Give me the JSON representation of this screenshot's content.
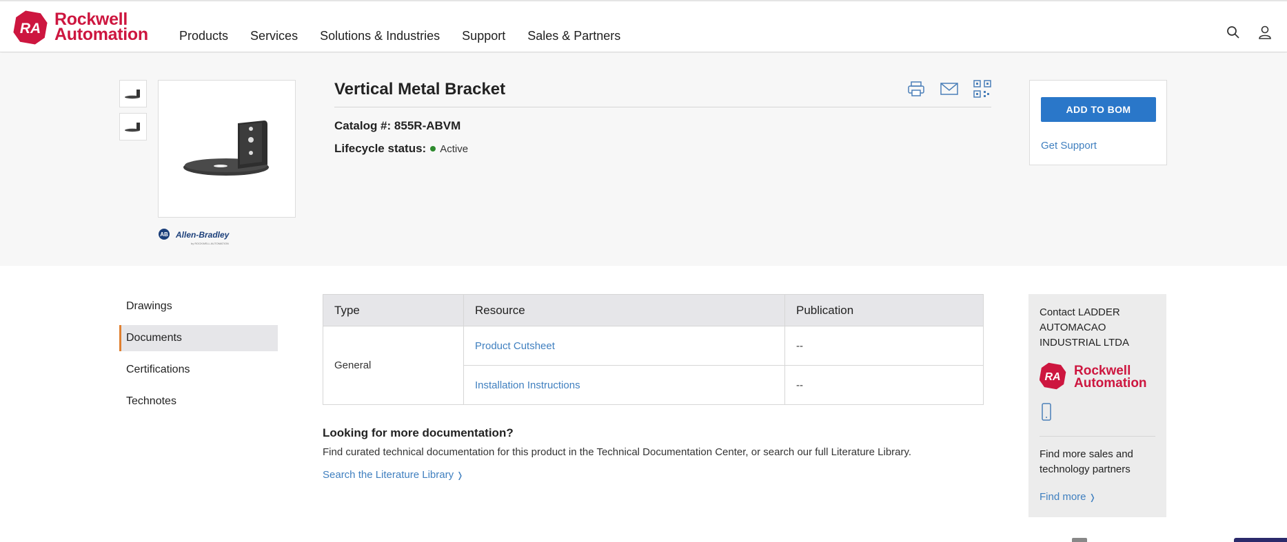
{
  "header": {
    "logo": {
      "mark": "RA",
      "line1": "Rockwell",
      "line2": "Automation"
    },
    "nav": [
      "Products",
      "Services",
      "Solutions & Industries",
      "Support",
      "Sales & Partners"
    ],
    "icons": [
      "search-icon",
      "user-icon"
    ]
  },
  "product": {
    "title": "Vertical Metal Bracket",
    "catalog_label": "Catalog #:",
    "catalog_value": "855R-ABVM",
    "lifecycle_label": "Lifecycle status:",
    "lifecycle_value": "Active",
    "lifecycle_color": "#2d8a2d",
    "brand": {
      "mark": "AB",
      "name": "Allen-Bradley",
      "sub": "by ROCKWELL AUTOMATION"
    },
    "action_icons": [
      "print-icon",
      "email-icon",
      "qr-code-icon"
    ]
  },
  "bom": {
    "button": "ADD TO BOM",
    "support_link": "Get Support"
  },
  "tabs": [
    {
      "label": "Drawings",
      "active": false
    },
    {
      "label": "Documents",
      "active": true
    },
    {
      "label": "Certifications",
      "active": false
    },
    {
      "label": "Technotes",
      "active": false
    }
  ],
  "documents": {
    "columns": [
      "Type",
      "Resource",
      "Publication"
    ],
    "type": "General",
    "rows": [
      {
        "resource": "Product Cutsheet",
        "publication": "--"
      },
      {
        "resource": "Installation Instructions",
        "publication": "--"
      }
    ]
  },
  "more_docs": {
    "heading": "Looking for more documentation?",
    "text": "Find curated technical documentation for this product in the Technical Documentation Center, or search our full Literature Library.",
    "link": "Search the Literature Library"
  },
  "contact": {
    "heading": "Contact LADDER AUTOMACAO INDUSTRIAL LTDA",
    "partners_text": "Find more sales and technology partners",
    "link": "Find more"
  },
  "colors": {
    "brand_red": "#cd163f",
    "button_blue": "#2a77c9",
    "link_blue": "#3f7fbf",
    "active_tab_accent": "#e08030"
  }
}
